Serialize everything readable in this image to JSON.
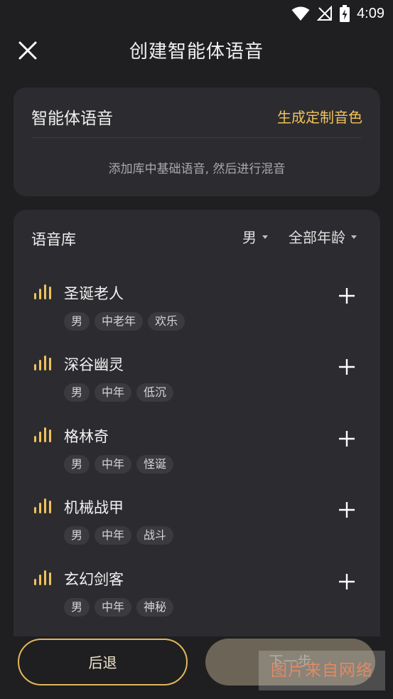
{
  "status_bar": {
    "time": "4:09",
    "icons": [
      "wifi-icon",
      "no-signal-icon",
      "battery-charging-icon"
    ]
  },
  "header": {
    "title": "创建智能体语音",
    "close_icon": "close-icon"
  },
  "agent_voice": {
    "title": "智能体语音",
    "custom_link": "生成定制音色",
    "hint": "添加库中基础语音, 然后进行混音"
  },
  "library": {
    "title": "语音库",
    "filter_gender": "男",
    "filter_age": "全部年龄",
    "items": [
      {
        "name": "圣诞老人",
        "tags": [
          "男",
          "中老年",
          "欢乐"
        ]
      },
      {
        "name": "深谷幽灵",
        "tags": [
          "男",
          "中年",
          "低沉"
        ]
      },
      {
        "name": "格林奇",
        "tags": [
          "男",
          "中年",
          "怪诞"
        ]
      },
      {
        "name": "机械战甲",
        "tags": [
          "男",
          "中年",
          "战斗"
        ]
      },
      {
        "name": "玄幻剑客",
        "tags": [
          "男",
          "中年",
          "神秘"
        ]
      }
    ]
  },
  "footer": {
    "back_label": "后退",
    "next_label": "下一步",
    "watermark": "图片来自网络"
  },
  "colors": {
    "background": "#1f1f21",
    "card": "#2c2c30",
    "accent": "#f0c25a",
    "tag_bg": "#3a3a3f"
  }
}
